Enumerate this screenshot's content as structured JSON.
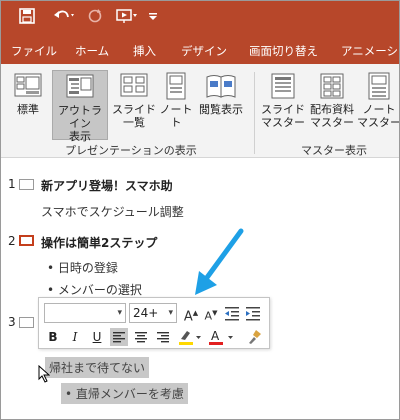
{
  "quick_access": {
    "items": [
      "save-icon",
      "undo-icon",
      "redo-icon",
      "present-from-beginning-icon",
      "customize-dropdown-icon"
    ]
  },
  "ribbon_tabs": [
    {
      "label": "ファイル"
    },
    {
      "label": "ホーム"
    },
    {
      "label": "挿入"
    },
    {
      "label": "デザイン"
    },
    {
      "label": "画面切り替え"
    },
    {
      "label": "アニメーション"
    }
  ],
  "ribbon": {
    "presentation_views": {
      "group_label": "プレゼンテーションの表示",
      "buttons": [
        {
          "label": "標準",
          "active": false
        },
        {
          "label": "アウトライン\n表示",
          "active": true
        },
        {
          "label": "スライド\n一覧",
          "active": false
        },
        {
          "label": "ノート\nト",
          "active": false
        },
        {
          "label": "閲覧表示",
          "active": false
        }
      ]
    },
    "master_views": {
      "group_label": "マスター表示",
      "buttons": [
        {
          "label": "スライド\nマスター"
        },
        {
          "label": "配布資料\nマスター"
        },
        {
          "label": "ノート\nマスター"
        }
      ]
    }
  },
  "outline": {
    "slides": [
      {
        "number": "1",
        "title": "新アプリ登場！スマホ助",
        "body": "スマホでスケジュール調整"
      },
      {
        "number": "2",
        "title": "操作は簡単2ステップ",
        "bullets": [
          "• 日時の登録",
          "• メンバーの選択"
        ]
      },
      {
        "number": "3",
        "highlighted_lines": [
          "帰社まで待てない",
          "• 直帰メンバーを考慮"
        ]
      }
    ]
  },
  "mini_toolbar": {
    "font_name": "",
    "font_size": "24+",
    "bold": "B",
    "italic": "I",
    "underline": "U",
    "grow_font": "A",
    "shrink_font": "A",
    "highlight_color": "#ffd800",
    "font_color": "#e21f1f"
  },
  "colors": {
    "accent": "#b7472a",
    "annotation_arrow": "#1ea0e6"
  }
}
